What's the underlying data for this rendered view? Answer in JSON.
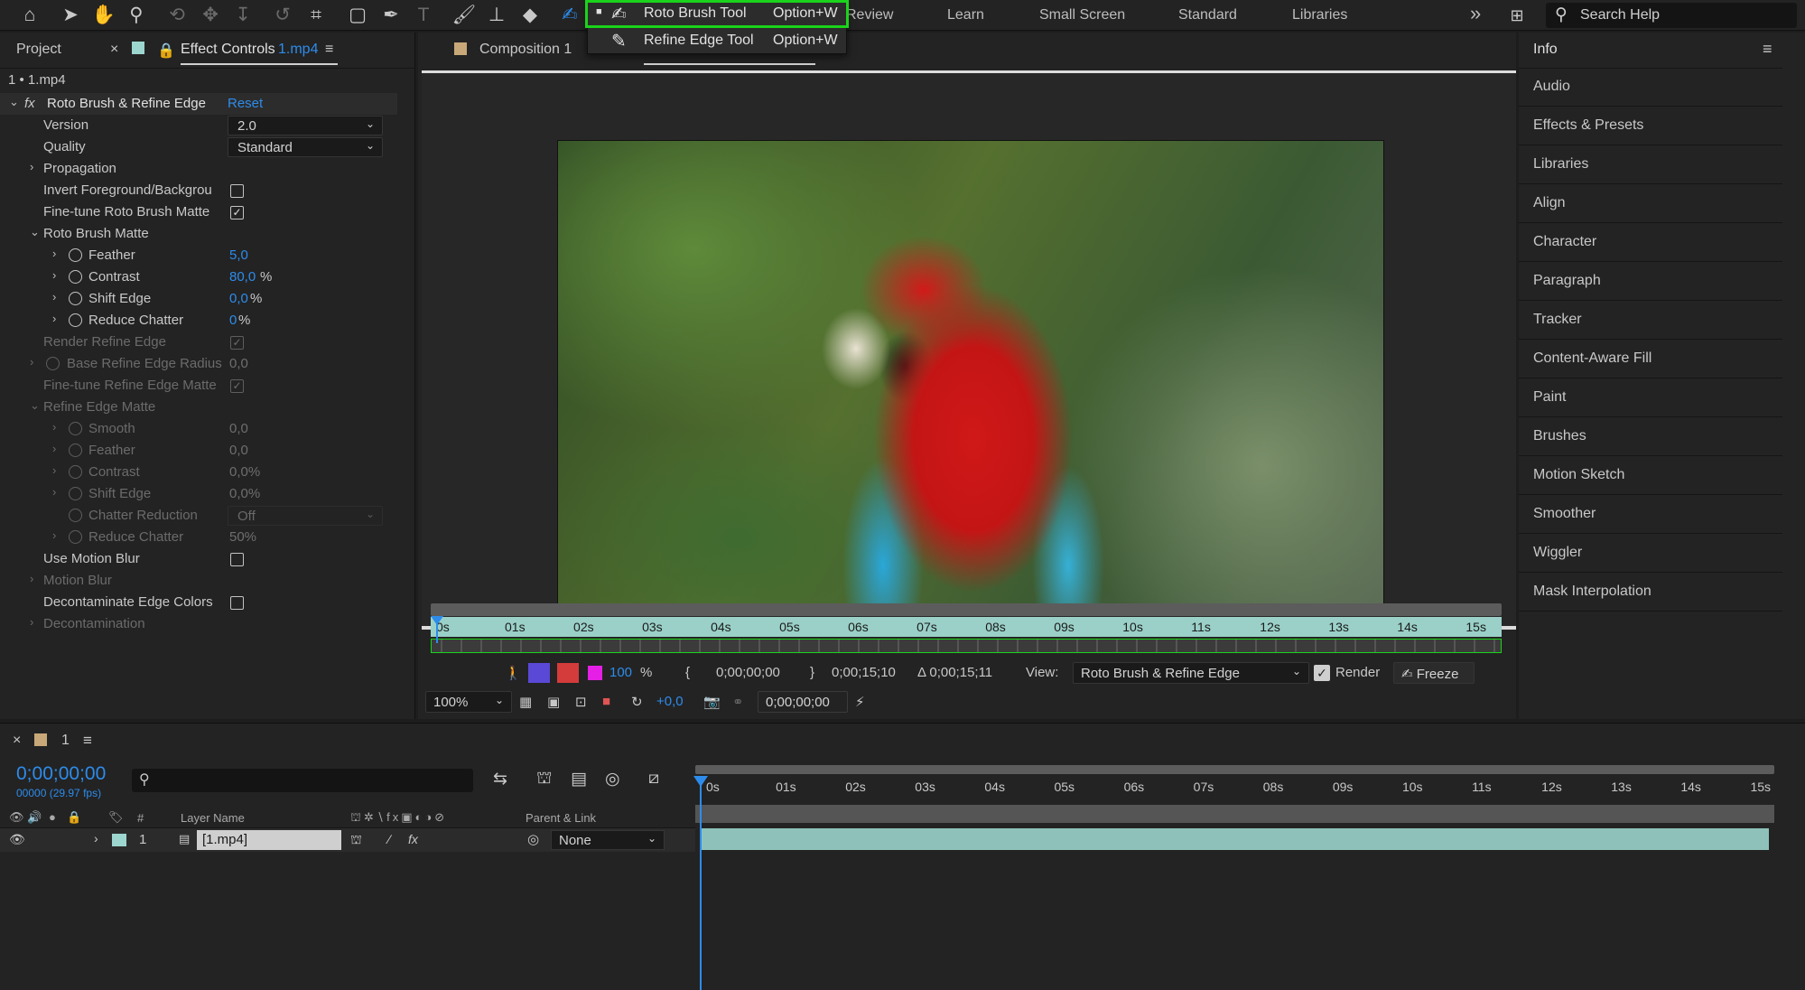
{
  "toolbar": {
    "icons": [
      "home-icon",
      "selection-icon",
      "hand-icon",
      "zoom-icon",
      "orbit-icon",
      "pan-icon",
      "dolly-icon",
      "rotate-icon",
      "anchor-icon",
      "rectangle-icon",
      "pen-icon",
      "type-icon",
      "brush-icon",
      "clone-stamp-icon",
      "eraser-icon",
      "roto-brush-icon"
    ],
    "workspaces": [
      "Review",
      "Learn",
      "Small Screen",
      "Standard",
      "Libraries"
    ],
    "more_label": "»",
    "search_placeholder": "Search Help"
  },
  "tool_menu": {
    "items": [
      {
        "bullet": "■",
        "label": "Roto Brush Tool",
        "shortcut": "Option+W"
      },
      {
        "bullet": "",
        "label": "Refine Edge Tool",
        "shortcut": "Option+W"
      }
    ]
  },
  "left_panel": {
    "tab_project": "Project",
    "tab_effect_controls": "Effect Controls",
    "tab_effect_file": "1.mp4",
    "layer_path": "1 • 1.mp4",
    "effect_name": "Roto Brush & Refine Edge",
    "reset_label": "Reset",
    "version_label": "Version",
    "version_value": "2.0",
    "quality_label": "Quality",
    "quality_value": "Standard",
    "propagation": "Propagation",
    "invert_fg": "Invert Foreground/Backgrou",
    "fine_tune_roto": "Fine-tune Roto Brush Matte",
    "roto_brush_matte": "Roto Brush Matte",
    "feather_label": "Feather",
    "feather_value": "5,0",
    "contrast_label": "Contrast",
    "contrast_value": "80,0",
    "contrast_unit": "%",
    "shift_edge_label": "Shift Edge",
    "shift_edge_value": "0,0",
    "shift_edge_unit": "%",
    "reduce_chatter_label": "Reduce Chatter",
    "reduce_chatter_value": "0",
    "reduce_chatter_unit": "%",
    "render_refine_edge": "Render Refine Edge",
    "base_refine_radius": "Base Refine Edge Radius",
    "base_refine_radius_value": "0,0",
    "fine_tune_refine": "Fine-tune Refine Edge Matte",
    "refine_edge_matte": "Refine Edge Matte",
    "smooth_label": "Smooth",
    "smooth_value": "0,0",
    "r_feather_label": "Feather",
    "r_feather_value": "0,0",
    "r_contrast_label": "Contrast",
    "r_contrast_value": "0,0%",
    "r_shift_label": "Shift Edge",
    "r_shift_value": "0,0%",
    "chatter_reduction_label": "Chatter Reduction",
    "chatter_reduction_value": "Off",
    "r_reduce_chatter_label": "Reduce Chatter",
    "r_reduce_chatter_value": "50%",
    "use_motion_blur": "Use Motion Blur",
    "motion_blur": "Motion Blur",
    "decontaminate": "Decontaminate Edge Colors",
    "decontamination": "Decontamination"
  },
  "viewer": {
    "comp_tab": "Composition 1",
    "ruler_ticks": [
      "0s",
      "01s",
      "02s",
      "03s",
      "04s",
      "05s",
      "06s",
      "07s",
      "08s",
      "09s",
      "10s",
      "11s",
      "12s",
      "13s",
      "14s",
      "15s"
    ],
    "zoom_percent": "100",
    "zoom_unit": "%",
    "start_time": "0;00;00;00",
    "end_time": "0;00;15;10",
    "duration": "Δ 0;00;15;11",
    "view_label": "View:",
    "view_value": "Roto Brush & Refine Edge",
    "render_label": "Render",
    "freeze_label": "Freeze",
    "magnification": "100%",
    "exposure": "+0,0",
    "current_time": "0;00;00;00"
  },
  "right_panel": {
    "header": "Info",
    "items": [
      "Audio",
      "Effects & Presets",
      "Libraries",
      "Align",
      "Character",
      "Paragraph",
      "Tracker",
      "Content-Aware Fill",
      "Paint",
      "Brushes",
      "Motion Sketch",
      "Smoother",
      "Wiggler",
      "Mask Interpolation"
    ]
  },
  "timeline": {
    "tab_name": "1",
    "timecode": "0;00;00;00",
    "frame_info": "00000 (29.97 fps)",
    "search_placeholder": "",
    "col_hash": "#",
    "col_layer_name": "Layer Name",
    "col_parent": "Parent & Link",
    "layer_number": "1",
    "layer_name": "[1.mp4]",
    "parent_value": "None",
    "ruler_ticks": [
      "0s",
      "01s",
      "02s",
      "03s",
      "04s",
      "05s",
      "06s",
      "07s",
      "08s",
      "09s",
      "10s",
      "11s",
      "12s",
      "13s",
      "14s",
      "15s"
    ]
  }
}
